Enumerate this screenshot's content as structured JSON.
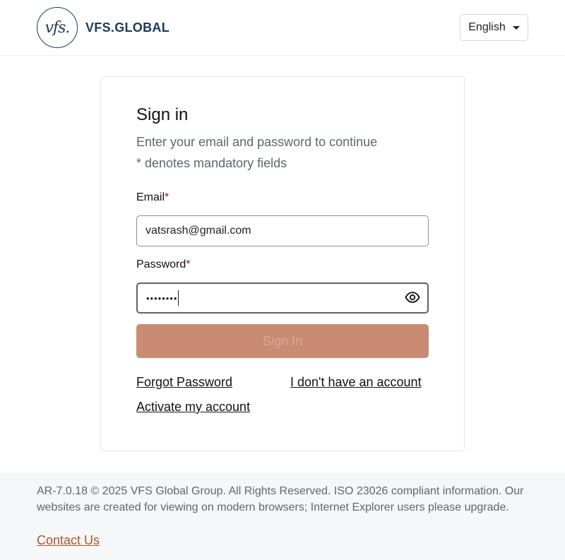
{
  "header": {
    "logo_mark": "vfs.",
    "logo_text": "VFS.GLOBAL",
    "language": "English"
  },
  "signin": {
    "title": "Sign in",
    "subtitle": "Enter your email and password to continue",
    "mandatory_note": "* denotes mandatory fields",
    "email_label": "Email",
    "email_value": "vatsrash@gmail.com",
    "password_label": "Password",
    "password_masked": "••••••••",
    "required_mark": "*",
    "button_label": "Sign In",
    "forgot_password": "Forgot Password",
    "no_account": "I don't have an account",
    "activate_account": "Activate my account"
  },
  "footer": {
    "text": "AR-7.0.18 © 2025 VFS Global Group. All Rights Reserved. ISO 23026 compliant information. Our websites are created for viewing on modern browsers; Internet Explorer users please upgrade.",
    "contact": "Contact Us"
  },
  "colors": {
    "brand": "#1b3a5c",
    "button_disabled": "#c98b74",
    "required": "#8b1c1c",
    "contact_link": "#b0532a"
  },
  "icons": {
    "password_toggle": "eye-icon",
    "language_dropdown": "caret-down-icon"
  }
}
